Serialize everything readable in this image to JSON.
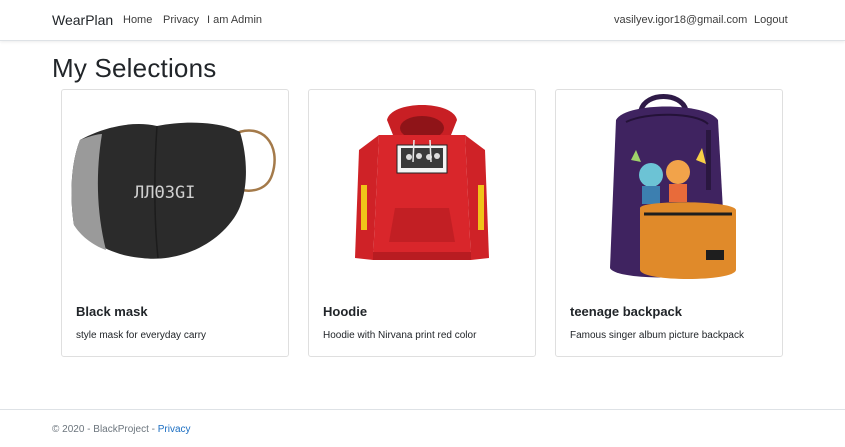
{
  "nav": {
    "brand": "WearPlan",
    "home": "Home",
    "privacy": "Privacy",
    "admin": "I am Admin",
    "user_email": "vasilyev.igor18@gmail.com",
    "logout": "Logout"
  },
  "page_title": "My Selections",
  "products": [
    {
      "title": "Black mask",
      "description": "style mask for everyday carry",
      "image_icon": "face-mask-image",
      "mask_print": "ЛЛΘЗGI"
    },
    {
      "title": "Hoodie",
      "description": "Hoodie with Nirvana print red color",
      "image_icon": "hoodie-image"
    },
    {
      "title": "teenage backpack",
      "description": "Famous singer album picture backpack",
      "image_icon": "backpack-image"
    }
  ],
  "footer": {
    "copyright": "© 2020 - BlackProject - ",
    "privacy_link": "Privacy"
  },
  "colors": {
    "link": "#1b6ec2",
    "mask": "#2b2b2b",
    "hoodie": "#d9262b",
    "backpack_body": "#3f2360",
    "backpack_pocket": "#e08a2a"
  }
}
